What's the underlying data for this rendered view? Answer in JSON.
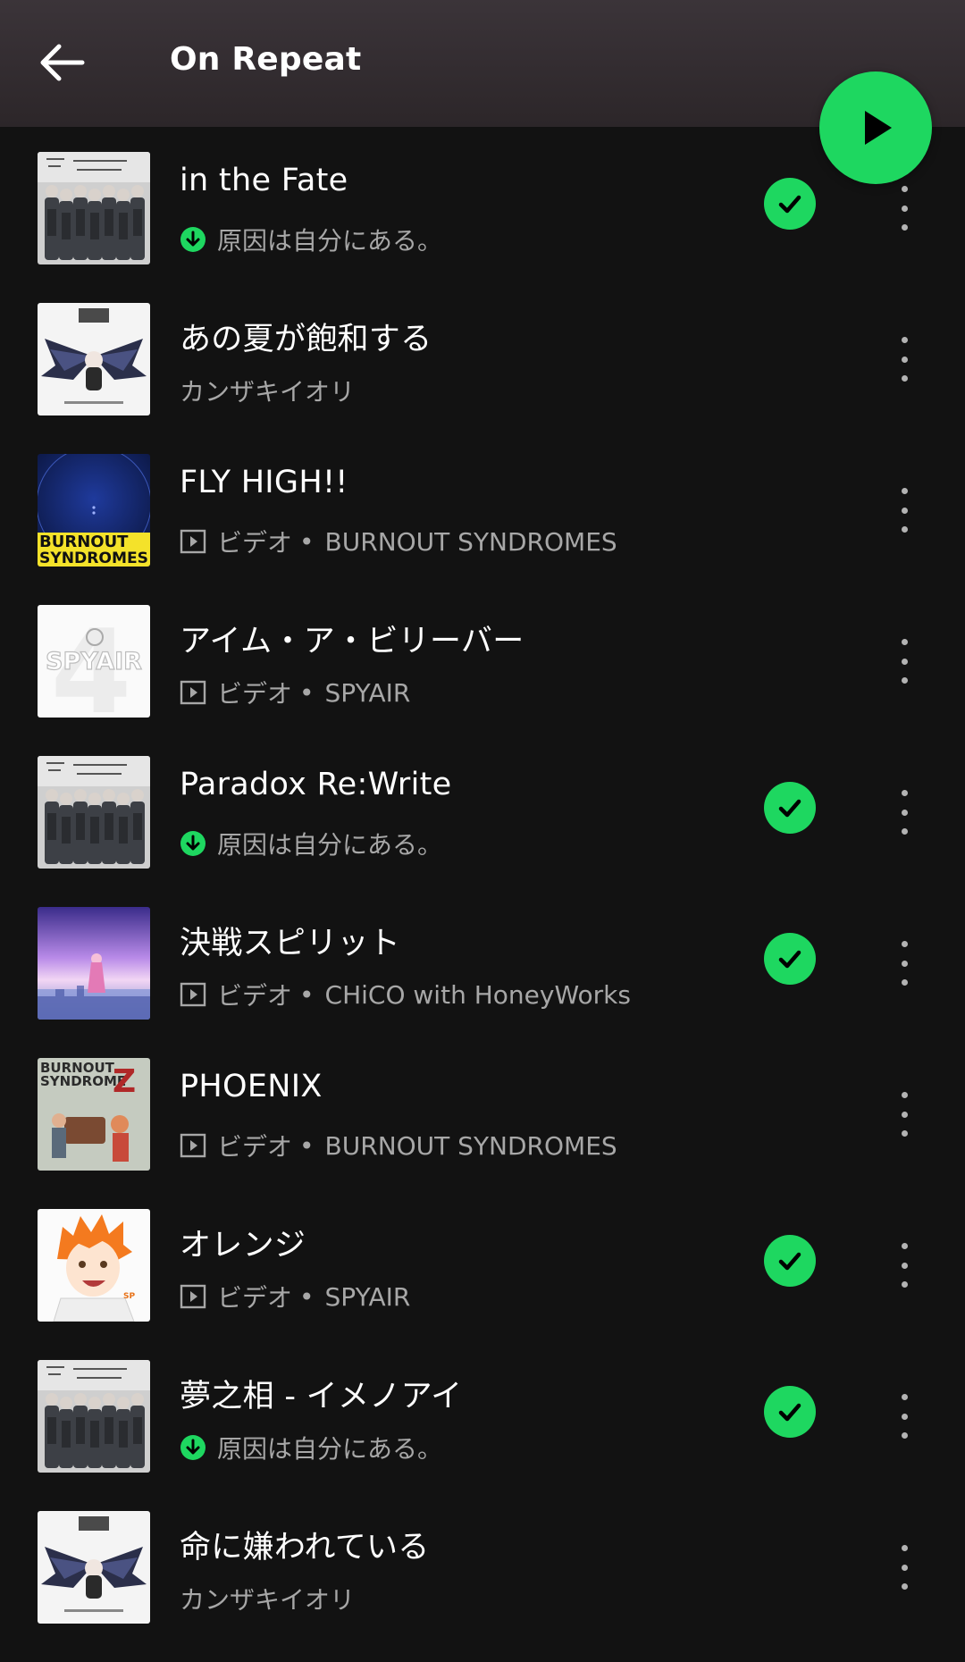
{
  "header": {
    "title": "On Repeat"
  },
  "colors": {
    "accent": "#1ed760",
    "background": "#121212",
    "subtext": "#a7a7a7"
  },
  "tracks": [
    {
      "title": "in the Fate",
      "meta_type": "downloaded",
      "artist": "原因は自分にある。",
      "added": true,
      "art": "group"
    },
    {
      "title": "あの夏が飽和する",
      "meta_type": "none",
      "artist": "カンザキイオリ",
      "added": false,
      "art": "hakushi"
    },
    {
      "title": "FLY HIGH!!",
      "meta_type": "video",
      "video_label": "ビデオ",
      "separator": "•",
      "artist": "BURNOUT SYNDROMES",
      "added": false,
      "art": "burnout-blue",
      "art_text": [
        "BURNOUT",
        "SYNDROMES"
      ]
    },
    {
      "title": "アイム・ア・ビリーバー",
      "meta_type": "video",
      "video_label": "ビデオ",
      "separator": "•",
      "artist": "SPYAIR",
      "added": false,
      "art": "spyair4",
      "art_text": [
        "SPYAIR",
        "4"
      ]
    },
    {
      "title": "Paradox Re:Write",
      "meta_type": "downloaded",
      "artist": "原因は自分にある。",
      "added": true,
      "art": "group"
    },
    {
      "title": "決戦スピリット",
      "meta_type": "video",
      "video_label": "ビデオ",
      "separator": "•",
      "artist": "CHiCO with HoneyWorks",
      "added": true,
      "art": "sky"
    },
    {
      "title": "PHOENIX",
      "meta_type": "video",
      "video_label": "ビデオ",
      "separator": "•",
      "artist": "BURNOUT SYNDROMES",
      "added": false,
      "art": "burnout-z",
      "art_text": [
        "BURNOUT",
        "SYNDROME",
        "Z"
      ]
    },
    {
      "title": "オレンジ",
      "meta_type": "video",
      "video_label": "ビデオ",
      "separator": "•",
      "artist": "SPYAIR",
      "added": true,
      "art": "anime"
    },
    {
      "title": "夢之相 - イメノアイ",
      "meta_type": "downloaded",
      "artist": "原因は自分にある。",
      "added": true,
      "art": "group"
    },
    {
      "title": "命に嫌われている",
      "meta_type": "none",
      "artist": "カンザキイオリ",
      "added": false,
      "art": "hakushi"
    }
  ],
  "icons": {
    "back": "arrow-left-icon",
    "play": "play-icon",
    "downloaded": "download-arrow-icon",
    "video": "video-icon",
    "added": "check-icon",
    "more": "more-vertical-icon"
  }
}
